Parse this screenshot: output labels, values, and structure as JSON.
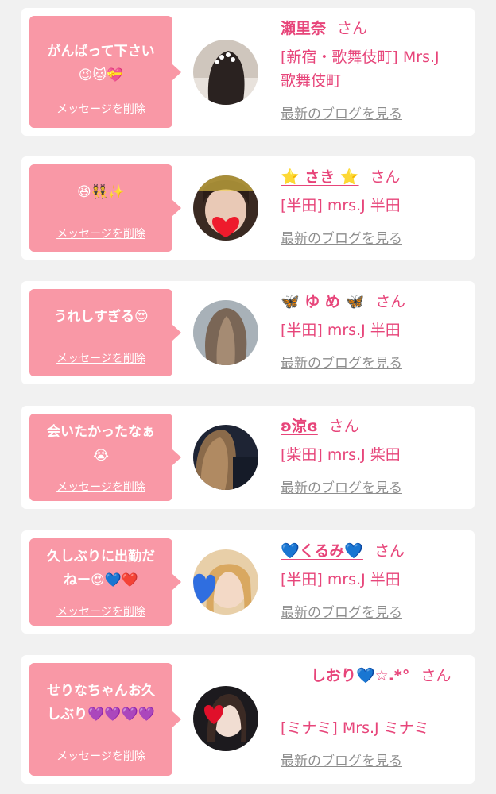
{
  "delete_label": "メッセージを削除",
  "blog_label": "最新のブログを見る",
  "honorific": "さん",
  "colors": {
    "accent": "#e7457a",
    "bubble": "#f998a6",
    "background": "#f1f1f1"
  },
  "cards": [
    {
      "message_lines": [
        "がんばって下さい",
        "😉🐱💝"
      ],
      "name": "瀬里奈",
      "shop_lines": [
        "[新宿・歌舞伎町] Mrs.J",
        "歌舞伎町"
      ]
    },
    {
      "message_lines": [
        "😆👯✨"
      ],
      "name": "⭐️ さき ⭐️",
      "shop_lines": [
        "[半田] mrs.J 半田"
      ]
    },
    {
      "message_lines": [
        "うれしすぎる😍"
      ],
      "name": "🦋 ゆ め 🦋",
      "shop_lines": [
        "[半田] mrs.J 半田"
      ]
    },
    {
      "message_lines": [
        "会いたかったなぁ",
        "😭"
      ],
      "name": "ʚ涼ɞ",
      "shop_lines": [
        "[柴田] mrs.J 柴田"
      ]
    },
    {
      "message_lines": [
        "久しぶりに出勤だ",
        "ねー😍💙❤️"
      ],
      "name": "💙くるみ💙",
      "shop_lines": [
        "[半田] mrs.J 半田"
      ]
    },
    {
      "message_lines": [
        "せりなちゃんお久",
        "しぶり💜💜💜💜"
      ],
      "name": "　　しおり💙☆.*°",
      "shop_lines": [
        "[ミナミ] Mrs.J ミナミ"
      ]
    }
  ]
}
